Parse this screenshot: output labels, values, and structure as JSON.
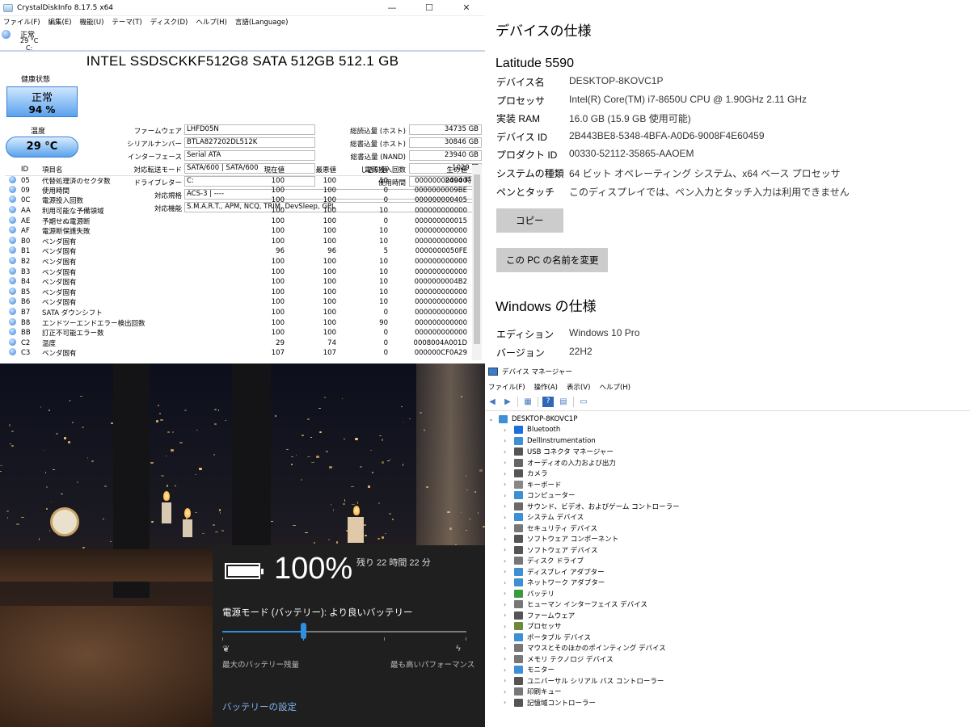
{
  "cdi": {
    "window_title": "CrystalDiskInfo 8.17.5 x64",
    "min": "—",
    "max": "☐",
    "close": "✕",
    "menu": [
      "ファイル(F)",
      "編集(E)",
      "機能(U)",
      "テーマ(T)",
      "ディスク(D)",
      "ヘルプ(H)",
      "言語(Language)"
    ],
    "drive_tab": {
      "status": "正常",
      "temp": "29 °C",
      "letter": "C:"
    },
    "model": "INTEL SSDSCKKF512G8 SATA 512GB 512.1 GB",
    "health_label": "健康状態",
    "health_status": "正常",
    "health_percent": "94 %",
    "temp_label": "温度",
    "temp_value": "29 °C",
    "left_info": [
      {
        "label": "ファームウェア",
        "value": "LHFD05N"
      },
      {
        "label": "シリアルナンバー",
        "value": "BTLA827202DL512K"
      },
      {
        "label": "インターフェース",
        "value": "Serial ATA"
      },
      {
        "label": "対応転送モード",
        "value": "SATA/600 | SATA/600"
      },
      {
        "label": "ドライブレター",
        "value": "C:"
      },
      {
        "label": "対応規格",
        "value": "ACS-3 | ----"
      },
      {
        "label": "対応機能",
        "value": "S.M.A.R.T., APM, NCQ, TRIM, DevSleep, GPL"
      }
    ],
    "right_info": [
      {
        "label": "総読込量 (ホスト)",
        "value": "34735 GB"
      },
      {
        "label": "総書込量 (ホスト)",
        "value": "30846 GB"
      },
      {
        "label": "総書込量 (NAND)",
        "value": "23940 GB"
      },
      {
        "label": "電源投入回数",
        "value": "1029 回"
      },
      {
        "label": "使用時間",
        "value": "2494 時間"
      }
    ],
    "table_headers": [
      "ID",
      "項目名",
      "現在値",
      "最悪値",
      "しきい値",
      "生の値"
    ],
    "table_rows": [
      [
        "05",
        "代替処理済のセクタ数",
        "100",
        "100",
        "10",
        "000000000000"
      ],
      [
        "09",
        "使用時間",
        "100",
        "100",
        "0",
        "0000000009BE"
      ],
      [
        "0C",
        "電源投入回数",
        "100",
        "100",
        "0",
        "000000000405"
      ],
      [
        "AA",
        "利用可能な予備領域",
        "100",
        "100",
        "10",
        "000000000000"
      ],
      [
        "AE",
        "予期せぬ電源断",
        "100",
        "100",
        "0",
        "000000000015"
      ],
      [
        "AF",
        "電源断保護失敗",
        "100",
        "100",
        "10",
        "000000000000"
      ],
      [
        "B0",
        "ベンダ固有",
        "100",
        "100",
        "10",
        "000000000000"
      ],
      [
        "B1",
        "ベンダ固有",
        "96",
        "96",
        "5",
        "0000000050FE"
      ],
      [
        "B2",
        "ベンダ固有",
        "100",
        "100",
        "10",
        "000000000000"
      ],
      [
        "B3",
        "ベンダ固有",
        "100",
        "100",
        "10",
        "000000000000"
      ],
      [
        "B4",
        "ベンダ固有",
        "100",
        "100",
        "10",
        "0000000004B2"
      ],
      [
        "B5",
        "ベンダ固有",
        "100",
        "100",
        "10",
        "000000000000"
      ],
      [
        "B6",
        "ベンダ固有",
        "100",
        "100",
        "10",
        "000000000000"
      ],
      [
        "B7",
        "SATA ダウンシフト",
        "100",
        "100",
        "0",
        "000000000000"
      ],
      [
        "B8",
        "エンドツーエンドエラー検出回数",
        "100",
        "100",
        "90",
        "000000000000"
      ],
      [
        "BB",
        "訂正不可能エラー数",
        "100",
        "100",
        "0",
        "000000000000"
      ],
      [
        "C2",
        "温度",
        "29",
        "74",
        "0",
        "0008004A001D"
      ],
      [
        "C3",
        "ベンダ固有",
        "107",
        "107",
        "0",
        "000000CF0A29"
      ]
    ]
  },
  "spec": {
    "device_heading": "デバイスの仕様",
    "model": "Latitude 5590",
    "rows": [
      {
        "k": "デバイス名",
        "v": "DESKTOP-8KOVC1P"
      },
      {
        "k": "プロセッサ",
        "v": "Intel(R) Core(TM) i7-8650U CPU @ 1.90GHz   2.11 GHz"
      },
      {
        "k": "実装 RAM",
        "v": "16.0 GB (15.9 GB 使用可能)"
      },
      {
        "k": "デバイス ID",
        "v": "2B443BE8-5348-4BFA-A0D6-9008F4E60459"
      },
      {
        "k": "プロダクト ID",
        "v": "00330-52112-35865-AAOEM"
      },
      {
        "k": "システムの種類",
        "v": "64 ビット オペレーティング システム、x64 ベース プロセッサ"
      },
      {
        "k": "ペンとタッチ",
        "v": "このディスプレイでは、ペン入力とタッチ入力は利用できません"
      }
    ],
    "copy_button": "コピー",
    "rename_button": "この PC の名前を変更",
    "windows_heading": "Windows の仕様",
    "win_rows": [
      {
        "k": "エディション",
        "v": "Windows 10 Pro"
      },
      {
        "k": "バージョン",
        "v": "22H2"
      }
    ]
  },
  "battery": {
    "percent": "100%",
    "charge_level": 1.0,
    "remaining": "残り 22 時間 22 分",
    "mode_label": "電源モード (バッテリー): より良いバッテリー",
    "slider_position": 0.33,
    "min_label": "最大のバッテリー残量",
    "max_label": "最も高いパフォーマンス",
    "settings_link": "バッテリーの設定",
    "accent": "#2e8fe0"
  },
  "devmgr": {
    "title": "デバイス マネージャー",
    "menu": [
      "ファイル(F)",
      "操作(A)",
      "表示(V)",
      "ヘルプ(H)"
    ],
    "root": "DESKTOP-8KOVC1P",
    "items": [
      {
        "label": "Bluetooth",
        "icon": "bluetooth-icon",
        "color": "#1e6fd9"
      },
      {
        "label": "DellInstrumentation",
        "icon": "monitor-icon",
        "color": "#3d8fd6"
      },
      {
        "label": "USB コネクタ マネージャー",
        "icon": "usb-icon",
        "color": "#555"
      },
      {
        "label": "オーディオの入力および出力",
        "icon": "speaker-icon",
        "color": "#666"
      },
      {
        "label": "カメラ",
        "icon": "camera-icon",
        "color": "#555"
      },
      {
        "label": "キーボード",
        "icon": "keyboard-icon",
        "color": "#888"
      },
      {
        "label": "コンピューター",
        "icon": "computer-icon",
        "color": "#3d8fd6"
      },
      {
        "label": "サウンド、ビデオ、およびゲーム コントローラー",
        "icon": "sound-icon",
        "color": "#6a6a6a"
      },
      {
        "label": "システム デバイス",
        "icon": "system-icon",
        "color": "#3d8fd6"
      },
      {
        "label": "セキュリティ デバイス",
        "icon": "security-icon",
        "color": "#777"
      },
      {
        "label": "ソフトウェア コンポーネント",
        "icon": "component-icon",
        "color": "#555"
      },
      {
        "label": "ソフトウェア デバイス",
        "icon": "software-icon",
        "color": "#555"
      },
      {
        "label": "ディスク ドライブ",
        "icon": "disk-icon",
        "color": "#777"
      },
      {
        "label": "ディスプレイ アダプター",
        "icon": "display-icon",
        "color": "#3d8fd6"
      },
      {
        "label": "ネットワーク アダプター",
        "icon": "network-icon",
        "color": "#3d8fd6"
      },
      {
        "label": "バッテリ",
        "icon": "battery-icon",
        "color": "#3b9a3b"
      },
      {
        "label": "ヒューマン インターフェイス デバイス",
        "icon": "hid-icon",
        "color": "#777"
      },
      {
        "label": "ファームウェア",
        "icon": "firmware-icon",
        "color": "#555"
      },
      {
        "label": "プロセッサ",
        "icon": "processor-icon",
        "color": "#6d8a3a"
      },
      {
        "label": "ポータブル デバイス",
        "icon": "portable-icon",
        "color": "#3d8fd6"
      },
      {
        "label": "マウスとそのほかのポインティング デバイス",
        "icon": "mouse-icon",
        "color": "#777"
      },
      {
        "label": "メモリ テクノロジ デバイス",
        "icon": "memory-icon",
        "color": "#777"
      },
      {
        "label": "モニター",
        "icon": "monitor-icon",
        "color": "#3d8fd6"
      },
      {
        "label": "ユニバーサル シリアル バス コントローラー",
        "icon": "usb-controller-icon",
        "color": "#555"
      },
      {
        "label": "印刷キュー",
        "icon": "printer-icon",
        "color": "#777"
      },
      {
        "label": "記憶域コントローラー",
        "icon": "storage-icon",
        "color": "#555"
      }
    ]
  }
}
